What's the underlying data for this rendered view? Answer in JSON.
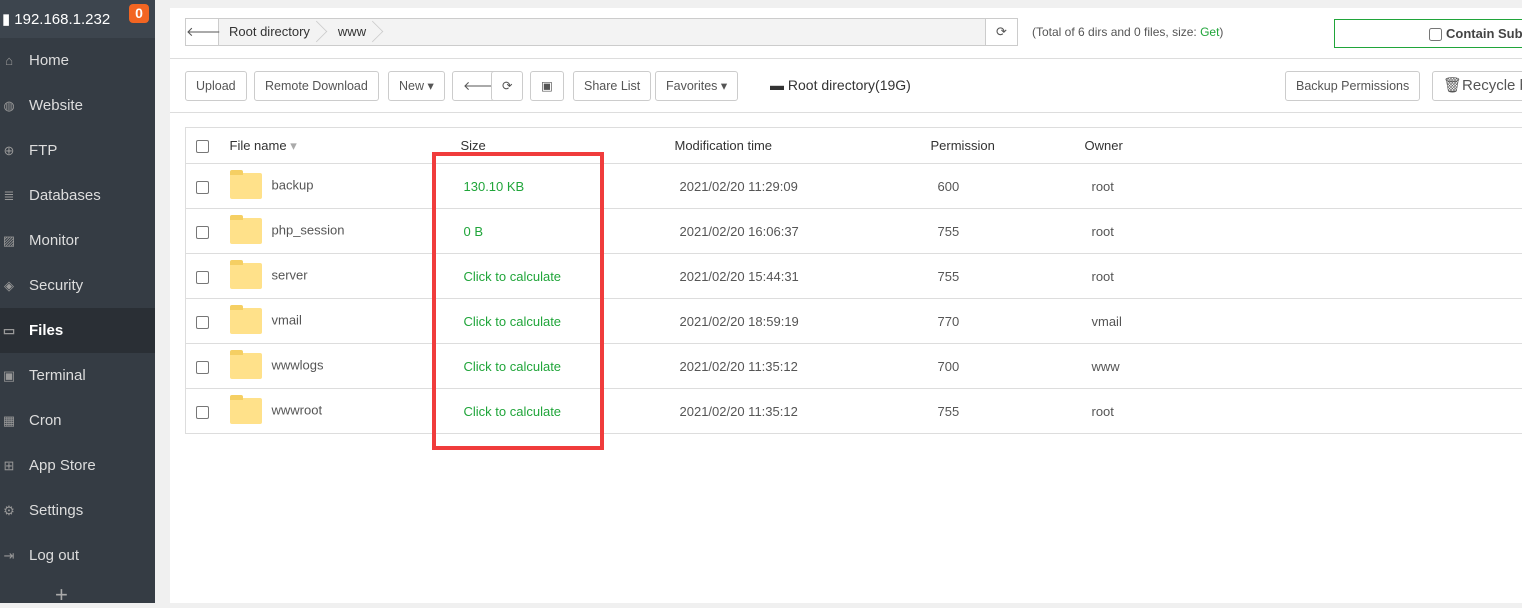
{
  "sidebar": {
    "ip": "192.168.1.232",
    "badge": "0",
    "items": [
      {
        "label": "Home",
        "icon": "⌂"
      },
      {
        "label": "Website",
        "icon": "◍"
      },
      {
        "label": "FTP",
        "icon": "⊕"
      },
      {
        "label": "Databases",
        "icon": "≣"
      },
      {
        "label": "Monitor",
        "icon": "▨"
      },
      {
        "label": "Security",
        "icon": "◈"
      },
      {
        "label": "Files",
        "icon": "▭"
      },
      {
        "label": "Terminal",
        "icon": "▣"
      },
      {
        "label": "Cron",
        "icon": "▦"
      },
      {
        "label": "App Store",
        "icon": "⊞"
      },
      {
        "label": "Settings",
        "icon": "⚙"
      },
      {
        "label": "Log out",
        "icon": "⇥"
      }
    ],
    "active": "Files",
    "plus": "+"
  },
  "breadcrumb": [
    "Root directory",
    "www"
  ],
  "summary": {
    "prefix": "(Total of 6 dirs and 0 files, size: ",
    "get": "Get",
    "suffix": ")"
  },
  "contain_label": "Contain Subd",
  "toolbar": {
    "upload": "Upload",
    "remote": "Remote Download",
    "new": "New ▾",
    "share": "Share List",
    "favorites": "Favorites ▾",
    "root": "Root directory(19G)",
    "backup": "Backup Permissions",
    "recycle": "Recycle b"
  },
  "columns": [
    "File name",
    "Size",
    "Modification time",
    "Permission",
    "Owner"
  ],
  "rows": [
    {
      "name": "backup",
      "size": "130.10 KB",
      "mtime": "2021/02/20 11:29:09",
      "perm": "600",
      "owner": "root"
    },
    {
      "name": "php_session",
      "size": "0 B",
      "mtime": "2021/02/20 16:06:37",
      "perm": "755",
      "owner": "root"
    },
    {
      "name": "server",
      "size": "Click to calculate",
      "mtime": "2021/02/20 15:44:31",
      "perm": "755",
      "owner": "root"
    },
    {
      "name": "vmail",
      "size": "Click to calculate",
      "mtime": "2021/02/20 18:59:19",
      "perm": "770",
      "owner": "vmail"
    },
    {
      "name": "wwwlogs",
      "size": "Click to calculate",
      "mtime": "2021/02/20 11:35:12",
      "perm": "700",
      "owner": "www"
    },
    {
      "name": "wwwroot",
      "size": "Click to calculate",
      "mtime": "2021/02/20 11:35:12",
      "perm": "755",
      "owner": "root"
    }
  ]
}
